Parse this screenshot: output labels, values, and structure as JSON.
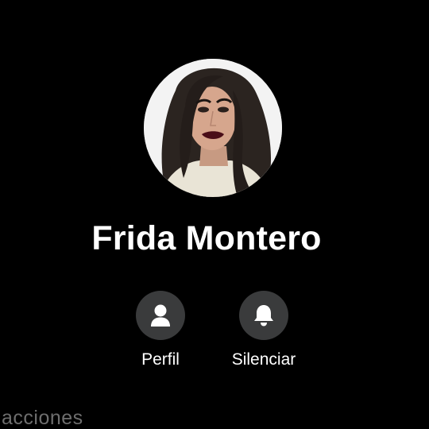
{
  "contact": {
    "name": "Frida Montero"
  },
  "actions": [
    {
      "label": "Perfil",
      "icon": "person-icon"
    },
    {
      "label": "Silenciar",
      "icon": "bell-icon"
    }
  ],
  "section": {
    "label": "acciones"
  },
  "colors": {
    "background": "#000000",
    "button": "#3a3b3c",
    "text": "#ffffff",
    "muted_text": "#6e6e6e"
  }
}
